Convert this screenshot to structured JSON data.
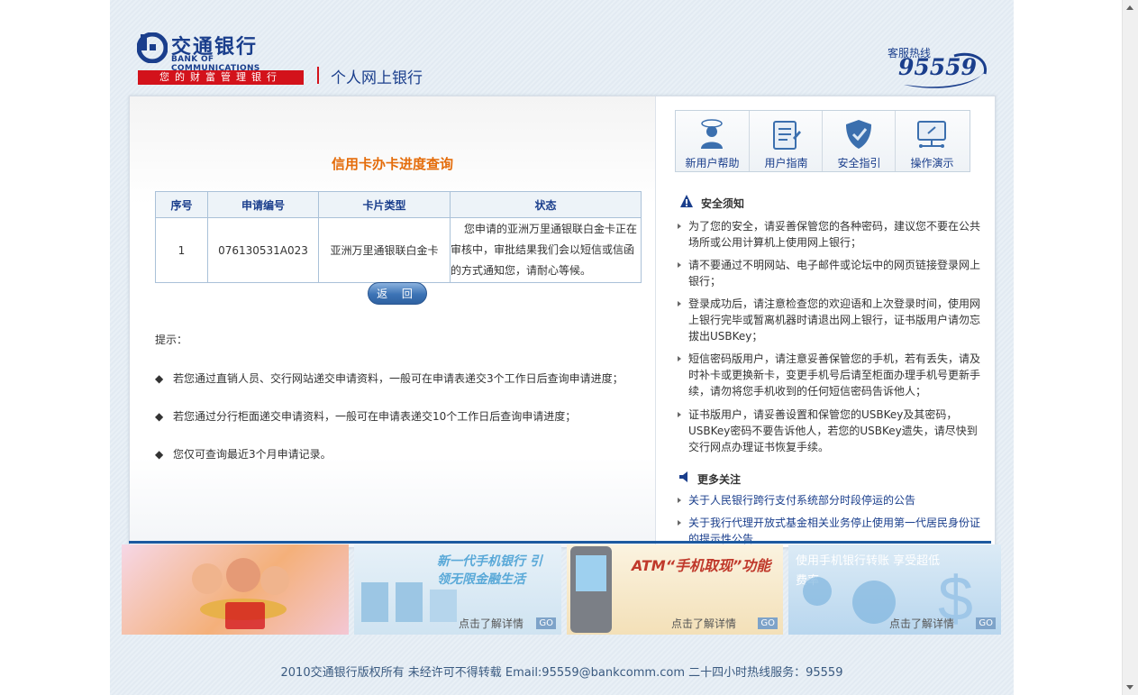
{
  "header": {
    "logo_cn": "交通银行",
    "logo_en": "BANK OF COMMUNICATIONS",
    "slogan": "您的财富管理银行",
    "title": "个人网上银行",
    "hotline_label": "客服热线",
    "hotline_number": "95559"
  },
  "quick_links": [
    {
      "label": "新用户帮助",
      "icon": "new-user-help-icon"
    },
    {
      "label": "用户指南",
      "icon": "user-guide-icon"
    },
    {
      "label": "安全指引",
      "icon": "security-shield-icon"
    },
    {
      "label": "操作演示",
      "icon": "demo-monitor-icon"
    }
  ],
  "main": {
    "form_title": "信用卡办卡进度查询",
    "table": {
      "columns": [
        "序号",
        "申请编号",
        "卡片类型",
        "状态"
      ],
      "rows": [
        {
          "index": "1",
          "application_no": "076130531A023",
          "card_type": "亚洲万里通银联白金卡",
          "status": "您申请的亚洲万里通银联白金卡正在审核中，审批结果我们会以短信或信函的方式通知您，请耐心等候。"
        }
      ]
    },
    "back_label": "返 回",
    "tips_label": "提示：",
    "tips": [
      "若您通过直销人员、交行网站递交申请资料，一般可在申请表递交3个工作日后查询申请进度；",
      "若您通过分行柜面递交申请资料，一般可在申请表递交10个工作日后查询申请进度；",
      "您仅可查询最近3个月申请记录。"
    ],
    "bullet": "◆"
  },
  "sidebar": {
    "security_title": "安全须知",
    "security_items": [
      "为了您的安全，请妥善保管您的各种密码，建议您不要在公共场所或公用计算机上使用网上银行；",
      "请不要通过不明网站、电子邮件或论坛中的网页链接登录网上银行；",
      "登录成功后，请注意检查您的欢迎语和上次登录时间，使用网上银行完毕或暂离机器时请退出网上银行，证书版用户请勿忘拔出USBKey；",
      "短信密码版用户，请注意妥善保管您的手机，若有丢失，请及时补卡或更换新卡，变更手机号后请至柜面办理手机号更新手续，请勿将您手机收到的任何短信密码告诉他人；",
      "证书版用户，请妥善设置和保管您的USBKey及其密码，USBKey密码不要告诉他人，若您的USBKey遗失，请尽快到交行网点办理证书恢复手续。"
    ],
    "more_title": "更多关注",
    "more_links": [
      "关于人民银行跨行支付系统部分时段停运的公告",
      "关于我行代理开放式基金相关业务停止使用第一代居民身份证的提示性公告"
    ]
  },
  "banners": [
    {
      "text": "",
      "sub": "",
      "go": ""
    },
    {
      "text": "新一代手机银行 引领无限金融生活",
      "sub": "点击了解详情",
      "go": "GO"
    },
    {
      "text": "ATM“手机取现”功能",
      "sub": "点击了解详情",
      "go": "GO"
    },
    {
      "text": "使用手机银行转账 享受超低费率",
      "sub": "点击了解详情",
      "go": "GO"
    }
  ],
  "footer": "2010交通银行版权所有  未经许可不得转载  Email:95559@bankcomm.com 二十四小时热线服务：95559",
  "colors": {
    "brand_blue": "#1a3e8c",
    "brand_red": "#d3121b",
    "title_orange": "#e46c0a"
  }
}
